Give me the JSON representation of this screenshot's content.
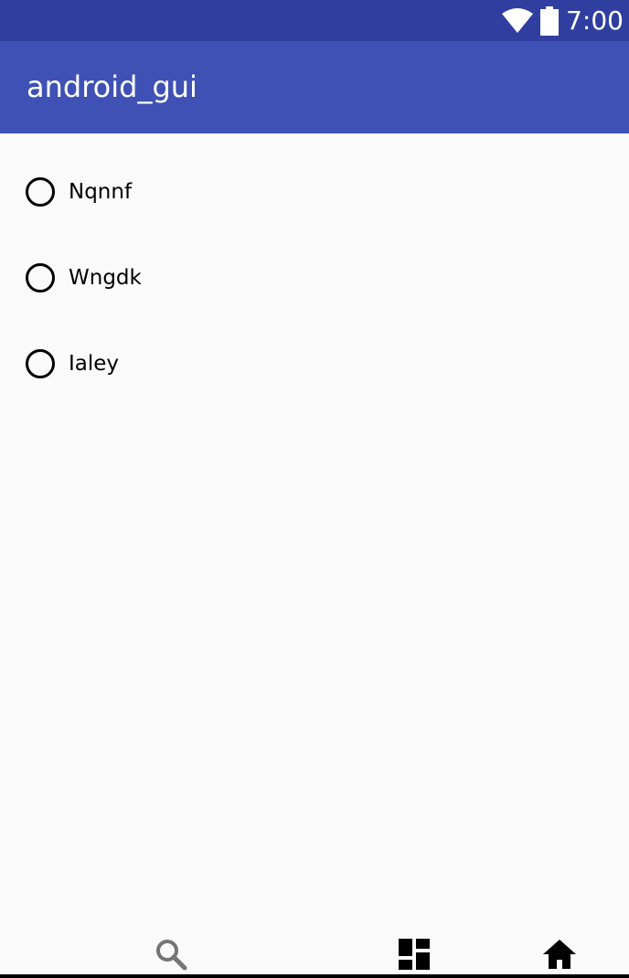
{
  "status_bar": {
    "time": "7:00",
    "wifi_icon": "wifi-icon",
    "battery_icon": "battery-icon",
    "color": "#303f9f"
  },
  "app_bar": {
    "title": "android_gui",
    "color": "#3f51b5"
  },
  "radio_group": {
    "options": [
      {
        "label": "Nqnnf",
        "selected": false
      },
      {
        "label": "Wngdk",
        "selected": false
      },
      {
        "label": "Ialey",
        "selected": false
      }
    ]
  },
  "bottom_nav": {
    "items": [
      {
        "icon": "search-icon"
      },
      {
        "icon": "dashboard-icon"
      },
      {
        "icon": "home-icon"
      }
    ]
  }
}
